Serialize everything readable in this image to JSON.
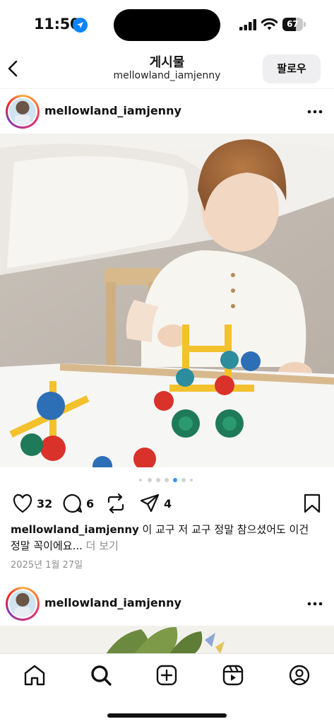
{
  "status_bar": {
    "time": "11:50",
    "battery_level": "67",
    "battery_fraction": 0.67
  },
  "nav": {
    "title": "게시물",
    "subtitle": "mellowland_iamjenny",
    "follow_label": "팔로우"
  },
  "post": {
    "username": "mellowland_iamjenny",
    "carousel": {
      "count": 7,
      "active_index": 4
    },
    "actions": {
      "likes": "32",
      "comments": "6",
      "shares": "4"
    },
    "caption": {
      "username": "mellowland_iamjenny",
      "text": " 이 교구 저 교구 정말 참으셨어도 이건 정말 꼭이에요... ",
      "more_label": "더 보기"
    },
    "date": "2025년 1월 27일"
  },
  "next_post": {
    "username": "mellowland_iamjenny"
  },
  "tab_bar": {
    "icons": [
      "home-icon",
      "search-icon",
      "create-icon",
      "reels-icon",
      "profile-icon"
    ],
    "active": "search-icon"
  },
  "colors": {
    "accent": "#3897f0",
    "dot_inactive": "#d2d2d2",
    "follow_bg": "#efeff1"
  }
}
